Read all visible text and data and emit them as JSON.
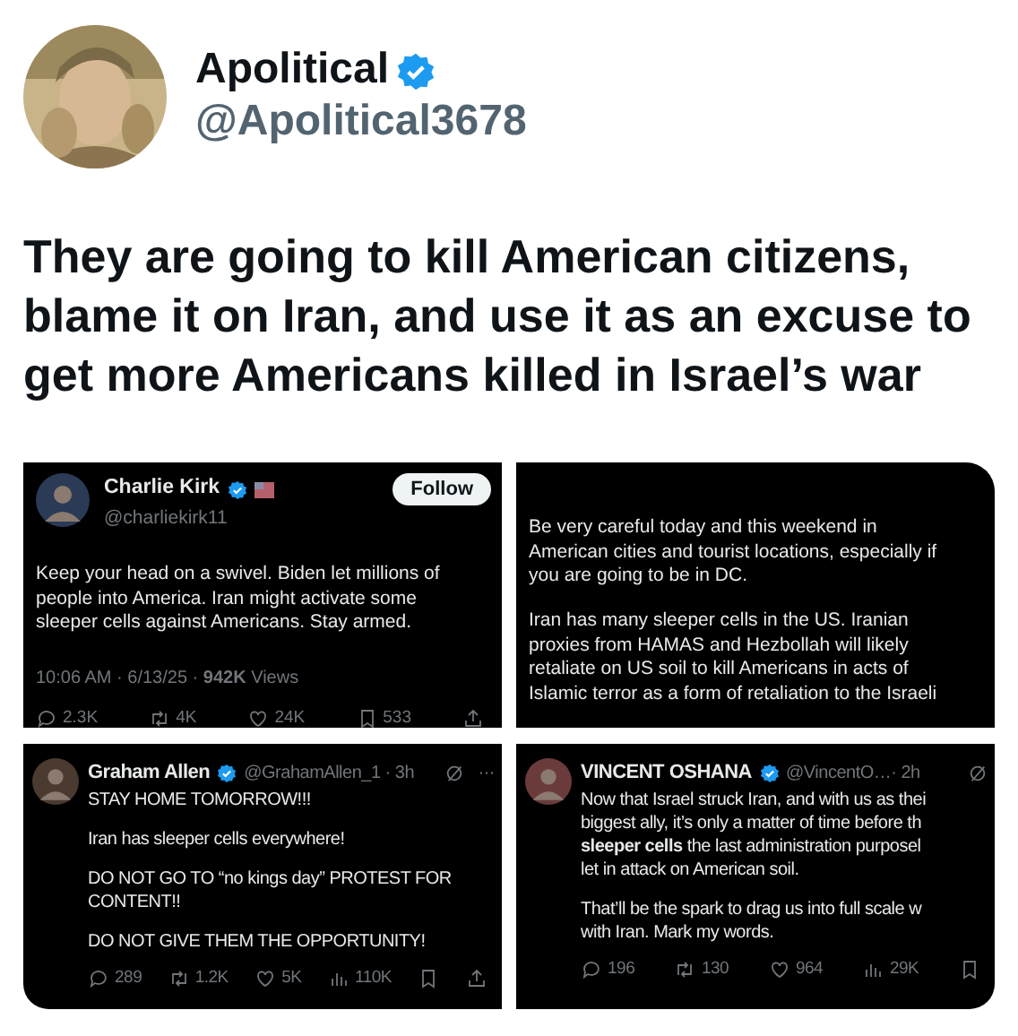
{
  "author": {
    "name": "Apolitical",
    "verified": true,
    "handle": "@Apolitical3678"
  },
  "text": "They are going to kill American citizens, blame it on Iran, and use it as an excuse to get more Americans killed in Israel’s war",
  "screenshots": [
    {
      "kind": "profile",
      "name": "Charlie Kirk",
      "verified": true,
      "flag": true,
      "handle": "@charliekirk11",
      "follow": "Follow",
      "paragraphs": [
        [
          "Keep your head on a swivel. Biden let millions of",
          "people into America. Iran might activate some",
          "sleeper cells against Americans. Stay armed."
        ]
      ],
      "meta": "10:06 AM · 6/13/25 · **942K** Views",
      "stats": [
        {
          "kind": "reply",
          "value": "2.3K"
        },
        {
          "kind": "repost",
          "value": "4K"
        },
        {
          "kind": "like",
          "value": "24K"
        },
        {
          "kind": "bookmark",
          "value": "533"
        },
        {
          "kind": "share"
        }
      ]
    },
    {
      "kind": "cropped",
      "paragraphs": [
        [
          "Be very careful today and this weekend in",
          "American cities and tourist locations, especially if",
          "you are going to be in DC."
        ],
        [
          "Iran has many sleeper cells in the US. Iranian",
          "proxies from HAMAS and Hezbollah will likely",
          "retaliate on US soil to kill Americans in acts of",
          "Islamic terror as a form of retaliation to the Israeli"
        ]
      ]
    },
    {
      "kind": "compact",
      "name": "Graham Allen",
      "verified": true,
      "handle": "@GrahamAllen_1 · 3h",
      "grok": true,
      "more": "···",
      "paragraphs": [
        [
          "STAY HOME TOMORROW!!!"
        ],
        [
          "Iran has sleeper cells everywhere!"
        ],
        [
          "DO NOT GO TO “no kings day” PROTEST FOR",
          "CONTENT!!"
        ],
        [
          "DO NOT GIVE THEM THE OPPORTUNITY!"
        ]
      ],
      "stats": [
        {
          "kind": "reply",
          "value": "289"
        },
        {
          "kind": "repost",
          "value": "1.2K"
        },
        {
          "kind": "like",
          "value": "5K"
        },
        {
          "kind": "views",
          "value": "110K"
        },
        {
          "kind": "bookmark"
        },
        {
          "kind": "share"
        }
      ]
    },
    {
      "kind": "compact",
      "name": "VINCENT OSHANA",
      "verified": true,
      "handle": "@VincentO…· 2h",
      "grok": true,
      "paragraphs": [
        [
          "Now that Israel struck Iran, and with us as thei",
          "biggest ally, it’s only a matter of time before th",
          "**sleeper cells** the last administration purposel",
          "let in attack on American soil."
        ],
        [
          "That’ll be the spark to drag us into full scale w",
          "with Iran. Mark my words."
        ]
      ],
      "stats": [
        {
          "kind": "reply",
          "value": "196"
        },
        {
          "kind": "repost",
          "value": "130"
        },
        {
          "kind": "like",
          "value": "964"
        },
        {
          "kind": "views",
          "value": "29K"
        },
        {
          "kind": "bookmark"
        }
      ]
    }
  ]
}
